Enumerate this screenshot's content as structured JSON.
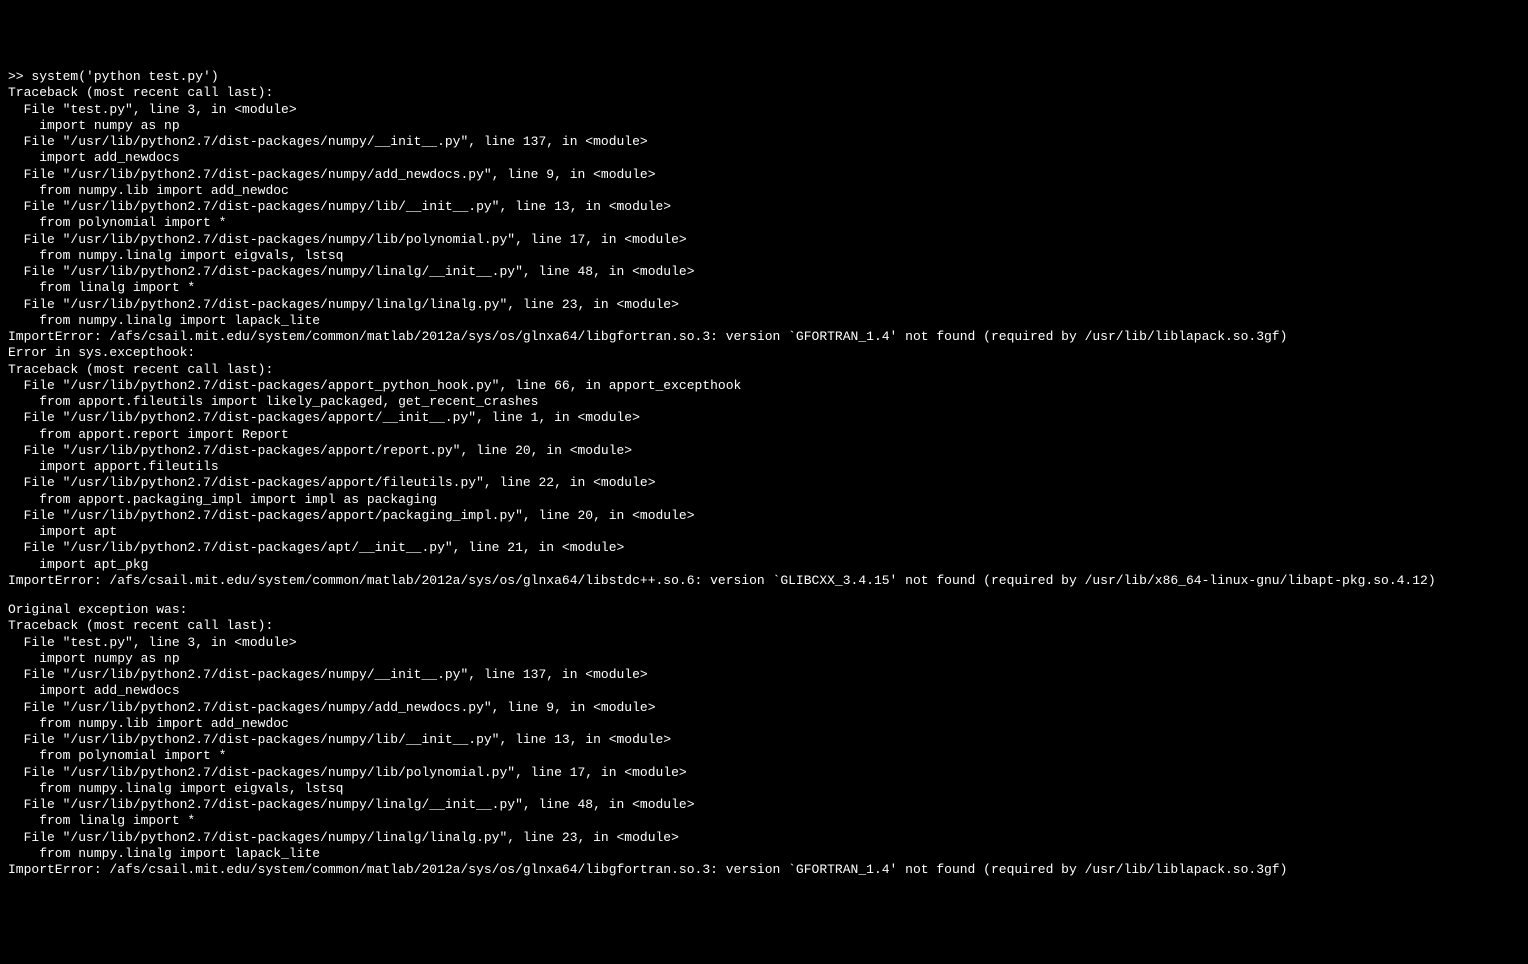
{
  "terminal": {
    "lines": [
      ">> system('python test.py')",
      "Traceback (most recent call last):",
      "  File \"test.py\", line 3, in <module>",
      "    import numpy as np",
      "  File \"/usr/lib/python2.7/dist-packages/numpy/__init__.py\", line 137, in <module>",
      "    import add_newdocs",
      "  File \"/usr/lib/python2.7/dist-packages/numpy/add_newdocs.py\", line 9, in <module>",
      "    from numpy.lib import add_newdoc",
      "  File \"/usr/lib/python2.7/dist-packages/numpy/lib/__init__.py\", line 13, in <module>",
      "    from polynomial import *",
      "  File \"/usr/lib/python2.7/dist-packages/numpy/lib/polynomial.py\", line 17, in <module>",
      "    from numpy.linalg import eigvals, lstsq",
      "  File \"/usr/lib/python2.7/dist-packages/numpy/linalg/__init__.py\", line 48, in <module>",
      "    from linalg import *",
      "  File \"/usr/lib/python2.7/dist-packages/numpy/linalg/linalg.py\", line 23, in <module>",
      "    from numpy.linalg import lapack_lite",
      "ImportError: /afs/csail.mit.edu/system/common/matlab/2012a/sys/os/glnxa64/libgfortran.so.3: version `GFORTRAN_1.4' not found (required by /usr/lib/liblapack.so.3gf)",
      "Error in sys.excepthook:",
      "Traceback (most recent call last):",
      "  File \"/usr/lib/python2.7/dist-packages/apport_python_hook.py\", line 66, in apport_excepthook",
      "    from apport.fileutils import likely_packaged, get_recent_crashes",
      "  File \"/usr/lib/python2.7/dist-packages/apport/__init__.py\", line 1, in <module>",
      "    from apport.report import Report",
      "  File \"/usr/lib/python2.7/dist-packages/apport/report.py\", line 20, in <module>",
      "    import apport.fileutils",
      "  File \"/usr/lib/python2.7/dist-packages/apport/fileutils.py\", line 22, in <module>",
      "    from apport.packaging_impl import impl as packaging",
      "  File \"/usr/lib/python2.7/dist-packages/apport/packaging_impl.py\", line 20, in <module>",
      "    import apt",
      "  File \"/usr/lib/python2.7/dist-packages/apt/__init__.py\", line 21, in <module>",
      "    import apt_pkg",
      "ImportError: /afs/csail.mit.edu/system/common/matlab/2012a/sys/os/glnxa64/libstdc++.so.6: version `GLIBCXX_3.4.15' not found (required by /usr/lib/x86_64-linux-gnu/libapt-pkg.so.4.12)",
      "",
      "Original exception was:",
      "Traceback (most recent call last):",
      "  File \"test.py\", line 3, in <module>",
      "    import numpy as np",
      "  File \"/usr/lib/python2.7/dist-packages/numpy/__init__.py\", line 137, in <module>",
      "    import add_newdocs",
      "  File \"/usr/lib/python2.7/dist-packages/numpy/add_newdocs.py\", line 9, in <module>",
      "    from numpy.lib import add_newdoc",
      "  File \"/usr/lib/python2.7/dist-packages/numpy/lib/__init__.py\", line 13, in <module>",
      "    from polynomial import *",
      "  File \"/usr/lib/python2.7/dist-packages/numpy/lib/polynomial.py\", line 17, in <module>",
      "    from numpy.linalg import eigvals, lstsq",
      "  File \"/usr/lib/python2.7/dist-packages/numpy/linalg/__init__.py\", line 48, in <module>",
      "    from linalg import *",
      "  File \"/usr/lib/python2.7/dist-packages/numpy/linalg/linalg.py\", line 23, in <module>",
      "    from numpy.linalg import lapack_lite",
      "ImportError: /afs/csail.mit.edu/system/common/matlab/2012a/sys/os/glnxa64/libgfortran.so.3: version `GFORTRAN_1.4' not found (required by /usr/lib/liblapack.so.3gf)"
    ]
  }
}
